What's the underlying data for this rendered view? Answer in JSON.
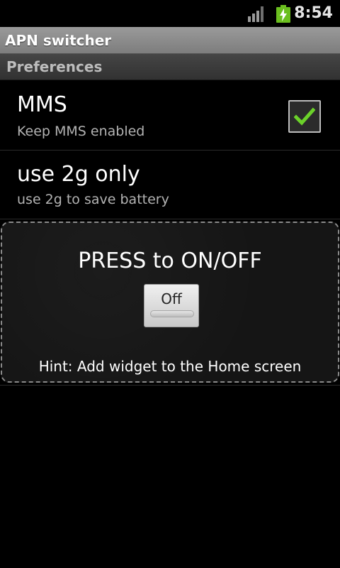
{
  "status_bar": {
    "time": "8:54",
    "signal_icon": "signal-bars-icon",
    "battery_icon": "battery-charging-icon",
    "battery_color": "#6bbf1f"
  },
  "app": {
    "title": "APN switcher"
  },
  "preferences": {
    "category_label": "Preferences",
    "items": [
      {
        "title": "MMS",
        "summary": "Keep MMS enabled",
        "checked": true
      },
      {
        "title": "use 2g only",
        "summary": "use 2g to save battery"
      }
    ]
  },
  "widget": {
    "heading": "PRESS to ON/OFF",
    "toggle_label": "Off",
    "hint": "Hint: Add widget to the Home screen"
  },
  "colors": {
    "check_mark": "#6bd12a",
    "title_bar": "#8a8a8a"
  }
}
